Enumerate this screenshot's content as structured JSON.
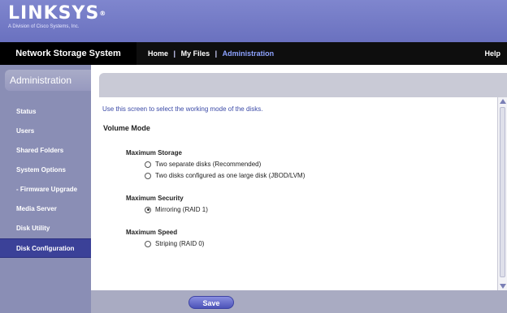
{
  "brand": {
    "logo": "LINKSYS",
    "registered": "®",
    "tagline": "A Division of Cisco Systems, Inc."
  },
  "nav": {
    "product": "Network Storage System",
    "links": [
      "Home",
      "My Files",
      "Administration"
    ],
    "separator": "|",
    "help": "Help",
    "active_index": 2
  },
  "sidebar": {
    "heading": "Administration",
    "items": [
      {
        "label": "Status"
      },
      {
        "label": "Users"
      },
      {
        "label": "Shared Folders"
      },
      {
        "label": "System Options"
      },
      {
        "label": "- Firmware Upgrade"
      },
      {
        "label": "Media Server"
      },
      {
        "label": "Disk Utility"
      },
      {
        "label": "Disk Configuration",
        "active": true
      }
    ]
  },
  "main": {
    "intro": "Use this screen to select the working mode of the disks.",
    "section_title": "Volume Mode",
    "groups": [
      {
        "title": "Maximum Storage",
        "options": [
          {
            "label": "Two separate disks (Recommended)",
            "checked": false
          },
          {
            "label": "Two disks configured as one large disk (JBOD/LVM)",
            "checked": false
          }
        ]
      },
      {
        "title": "Maximum Security",
        "options": [
          {
            "label": "Mirroring (RAID 1)",
            "checked": true
          }
        ]
      },
      {
        "title": "Maximum Speed",
        "options": [
          {
            "label": "Striping (RAID 0)",
            "checked": false
          }
        ]
      }
    ],
    "save_label": "Save"
  },
  "colors": {
    "header": "#7278c6",
    "nav_bg": "#0e0e0e",
    "sidebar_bg": "#8a8eb5",
    "active_item": "#3b4198",
    "link_text": "#3a49a6"
  }
}
